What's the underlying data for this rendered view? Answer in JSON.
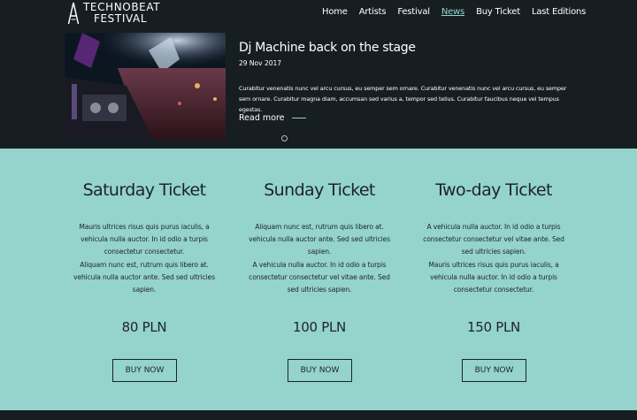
{
  "brand": {
    "line1": "TECHNOBEAT",
    "line2": "FESTIVAL",
    "logo_icon": "triangle-logo-icon"
  },
  "nav": {
    "items": [
      {
        "label": "Home"
      },
      {
        "label": "Artists"
      },
      {
        "label": "Festival"
      },
      {
        "label": "News"
      },
      {
        "label": "Buy Ticket"
      },
      {
        "label": "Last Editions"
      }
    ],
    "active": "News"
  },
  "news": {
    "title": "Dj Machine back on the stage",
    "date": "29 Nov 2017",
    "body": "Curabitur venenatis nunc vel arcu cursus, eu semper sem ornare. Curabitur venenatis nunc vel arcu cursus, eu semper sem ornare. Curabitur magna diam, accumsan sed varius a, tempor sed tellus. Curabitur faucibus neque vel tempus egestas.",
    "read_more": "Read more",
    "image": "dj-concert-photo"
  },
  "tickets": [
    {
      "title": "Saturday Ticket",
      "desc": [
        "Mauris ultrices risus quis purus iaculis, a",
        "vehicula nulla auctor. In id odio a turpis",
        "consectetur consectetur.",
        "Aliquam nunc est, rutrum quis libero at.",
        "vehicula nulla auctor ante. Sed sed ultricies",
        "sapien."
      ],
      "price": "80 PLN",
      "button": "BUY NOW"
    },
    {
      "title": "Sunday Ticket",
      "desc": [
        "Aliquam nunc est, rutrum quis libero at.",
        "vehicula nulla auctor ante. Sed sed ultricies",
        "sapien.",
        "A vehicula nulla auctor. In id odio a turpis",
        "consectetur consectetur vel vitae ante. Sed",
        "sed ultricies sapien."
      ],
      "price": "100 PLN",
      "button": "BUY NOW"
    },
    {
      "title": "Two-day Ticket",
      "desc": [
        "A vehicula nulla auctor. In id odio a turpis",
        "consectetur consectetur vel vitae ante. Sed",
        "sed ultricies sapien.",
        "Mauris ultrices risus quis purus iaculis, a",
        "vehicula nulla auctor. In id odio a turpis",
        "consectetur consectetur."
      ],
      "price": "150 PLN",
      "button": "BUY NOW"
    }
  ],
  "colors": {
    "dark": "#161e22",
    "accent": "#95d3cd",
    "text_dark": "#1c2428"
  }
}
